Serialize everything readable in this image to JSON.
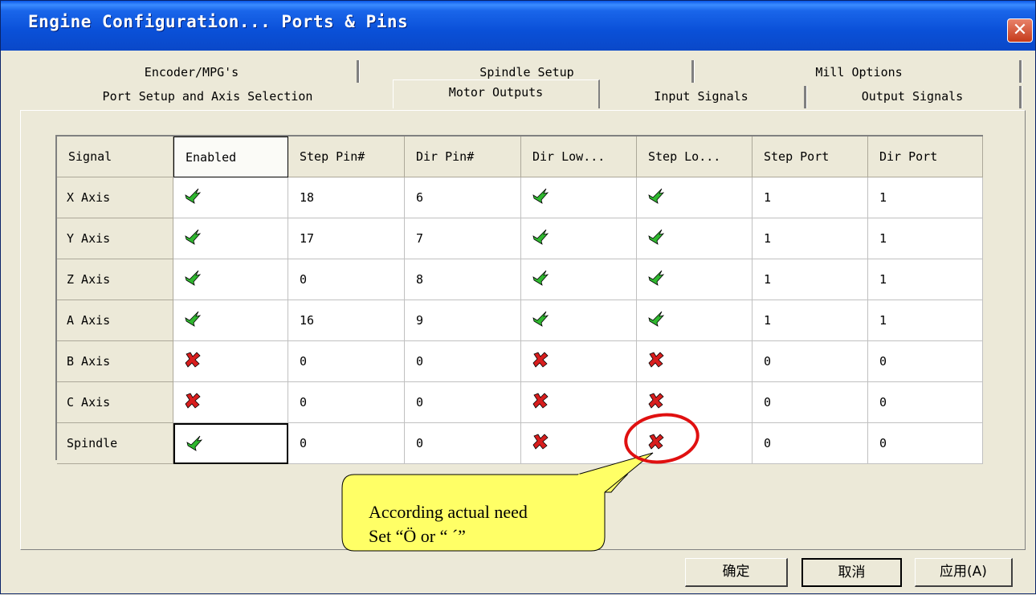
{
  "window": {
    "title": "Engine Configuration... Ports & Pins",
    "close_label": "✕"
  },
  "tabs_row_back": [
    {
      "label": "Encoder/MPG's"
    },
    {
      "label": "Spindle Setup"
    },
    {
      "label": "Mill Options"
    }
  ],
  "tabs_row_front": [
    {
      "label": "Port Setup and Axis Selection"
    },
    {
      "label": "Motor Outputs",
      "active": true
    },
    {
      "label": "Input Signals"
    },
    {
      "label": "Output Signals"
    }
  ],
  "table": {
    "columns": [
      "Signal",
      "Enabled",
      "Step Pin#",
      "Dir Pin#",
      "Dir Low...",
      "Step Lo...",
      "Step Port",
      "Dir Port"
    ],
    "rows": [
      {
        "signal": "X Axis",
        "enabled": "check-icon",
        "step_pin": "18",
        "dir_pin": "6",
        "dir_low": "check-icon",
        "step_low": "check-icon",
        "step_port": "1",
        "dir_port": "1"
      },
      {
        "signal": "Y Axis",
        "enabled": "check-icon",
        "step_pin": "17",
        "dir_pin": "7",
        "dir_low": "check-icon",
        "step_low": "check-icon",
        "step_port": "1",
        "dir_port": "1"
      },
      {
        "signal": "Z Axis",
        "enabled": "check-icon",
        "step_pin": "0",
        "dir_pin": "8",
        "dir_low": "check-icon",
        "step_low": "check-icon",
        "step_port": "1",
        "dir_port": "1"
      },
      {
        "signal": "A Axis",
        "enabled": "check-icon",
        "step_pin": "16",
        "dir_pin": "9",
        "dir_low": "check-icon",
        "step_low": "check-icon",
        "step_port": "1",
        "dir_port": "1"
      },
      {
        "signal": "B Axis",
        "enabled": "cross-icon",
        "step_pin": "0",
        "dir_pin": "0",
        "dir_low": "cross-icon",
        "step_low": "cross-icon",
        "step_port": "0",
        "dir_port": "0"
      },
      {
        "signal": "C Axis",
        "enabled": "cross-icon",
        "step_pin": "0",
        "dir_pin": "0",
        "dir_low": "cross-icon",
        "step_low": "cross-icon",
        "step_port": "0",
        "dir_port": "0"
      },
      {
        "signal": "Spindle",
        "enabled": "check-icon",
        "step_pin": "0",
        "dir_pin": "0",
        "dir_low": "cross-icon",
        "step_low": "cross-icon",
        "step_port": "0",
        "dir_port": "0"
      }
    ]
  },
  "callout": {
    "line1": "According actual need",
    "line2": "Set “Ö   or “ ´”"
  },
  "buttons": {
    "ok": "确定",
    "cancel": "取消",
    "apply": "应用(A)"
  },
  "colors": {
    "check": "#2fb82f",
    "cross": "#d81e1e",
    "highlight_circle": "#e01010",
    "callout_fill": "#ffff66"
  }
}
